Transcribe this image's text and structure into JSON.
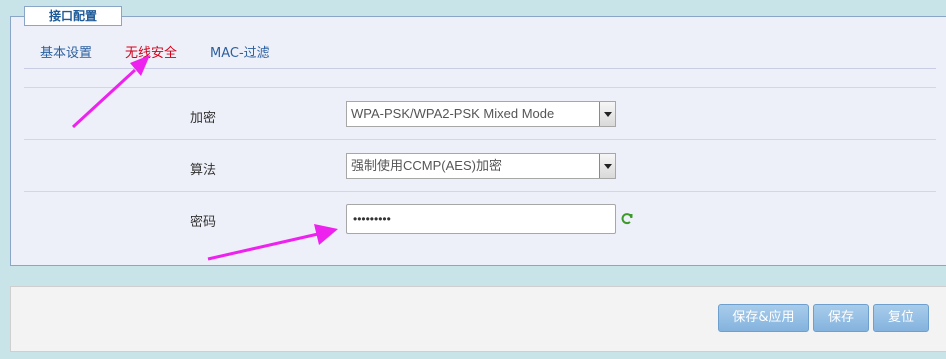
{
  "panel": {
    "title": "接口配置"
  },
  "tabs": [
    {
      "label": "基本设置",
      "active": false
    },
    {
      "label": "无线安全",
      "active": true
    },
    {
      "label": "MAC-过滤",
      "active": false
    }
  ],
  "form": {
    "encryption": {
      "label": "加密",
      "value": "WPA-PSK/WPA2-PSK Mixed Mode"
    },
    "algorithm": {
      "label": "算法",
      "value": "强制使用CCMP(AES)加密"
    },
    "password": {
      "label": "密码",
      "value": "•••••••••"
    }
  },
  "buttons": {
    "save_apply": "保存&应用",
    "save": "保存",
    "reset": "复位"
  },
  "colors": {
    "active_tab": "#d0021b",
    "tab": "#2b5f9e",
    "annotation_arrow": "#ee22ee",
    "button": "#95bfe5"
  }
}
